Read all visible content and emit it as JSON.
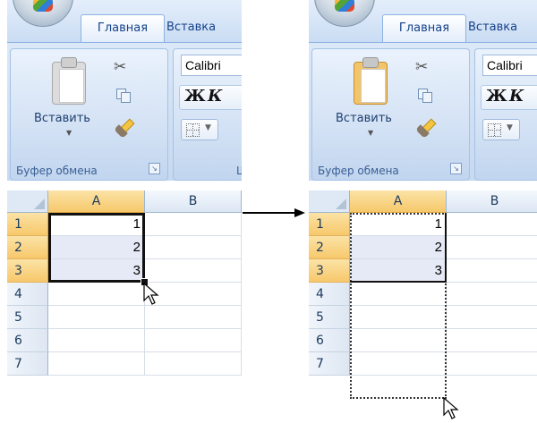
{
  "ribbon": {
    "tab_home": "Главная",
    "tab_insert": "Вставка",
    "paste_label": "Вставить",
    "clipboard_group": "Буфер обмена",
    "font_name": "Calibri",
    "bold_label": "Ж",
    "italic_label": "К",
    "font_group_partial": "Ш"
  },
  "sheet": {
    "columns": [
      "A",
      "B"
    ],
    "rows": [
      "1",
      "2",
      "3",
      "4",
      "5",
      "6",
      "7"
    ],
    "values_col_a": [
      "1",
      "2",
      "3",
      "",
      "",
      "",
      ""
    ]
  },
  "icons": {
    "transition_arrow": "right-arrow-icon",
    "cursor": "mouse-pointer-icon"
  },
  "colors": {
    "selected_header": "#f7c86b",
    "highlight_cell": "#e6eaf6",
    "ribbon": "#c7d9f0"
  }
}
